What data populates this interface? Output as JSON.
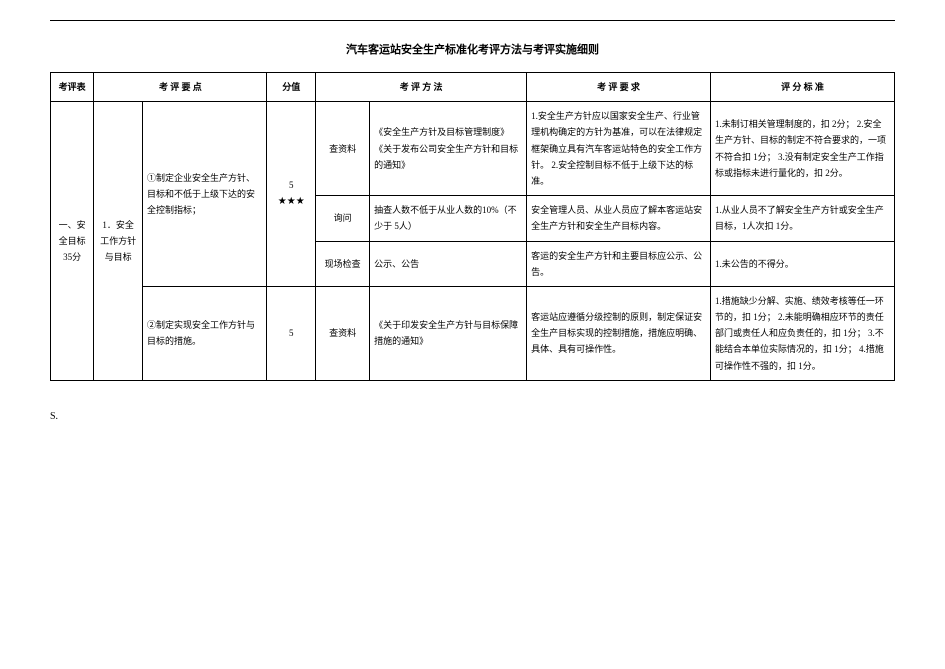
{
  "title": "汽车客运站安全生产标准化考评方法与考评实施细则",
  "headers": {
    "col1": "考评表",
    "col2": "考 评 要 点",
    "col3": "分值",
    "col4": "考 评 方 法",
    "col5": "考 评 要 求",
    "col6": "评 分 标 准"
  },
  "section": {
    "name": "一、安全目标 35分",
    "sub": "1．安全工作方针与目标"
  },
  "rows": {
    "r1": {
      "point": "①制定企业安全生产方针、目标和不低于上级下达的安全控制指标；",
      "score": "5",
      "stars": "★★★",
      "method_a": "查资料",
      "method_a_desc": "《安全生产方针及目标管理制度》\n《关于发布公司安全生产方针和目标的通知》",
      "req_a": "1.安全生产方针应以国家安全生产、行业管理机构确定的方针为基准，可以在法律规定框架确立具有汽车客运站特色的安全工作方针。\n2.安全控制目标不低于上级下达的标准。",
      "std_a": "1.未制订相关管理制度的，扣 2分；\n2.安全生产方针、目标的制定不符合要求的，一项不符合扣 1分；\n3.没有制定安全生产工作指标或指标未进行量化的，扣 2分。",
      "method_b": "询问",
      "method_b_desc": "抽查人数不低于从业人数的10%（不少于 5人）",
      "req_b": "安全管理人员、从业人员应了解本客运站安全生产方针和安全生产目标内容。",
      "std_b": "1.从业人员不了解安全生产方针或安全生产目标，1人次扣 1分。",
      "method_c": "现场检查",
      "method_c_desc": "公示、公告",
      "req_c": "客运的安全生产方针和主要目标应公示、公告。",
      "std_c": "1.未公告的不得分。"
    },
    "r2": {
      "point": "②制定实现安全工作方针与目标的措施。",
      "score": "5",
      "method": "查资料",
      "method_desc": "《关于印发安全生产方针与目标保障措施的通知》",
      "req": "客运站应遵循分级控制的原则，制定保证安全生产目标实现的控制措施，措施应明确、具体、具有可操作性。",
      "std": "1.措施缺少分解、实施、绩效考核等任一环节的，扣 1分；\n2.未能明确相应环节的责任部门或责任人和应负责任的，扣 1分；\n3.不能结合本单位实际情况的，扣 1分；\n4.措施可操作性不强的，扣 1分。"
    }
  },
  "footer": "S."
}
